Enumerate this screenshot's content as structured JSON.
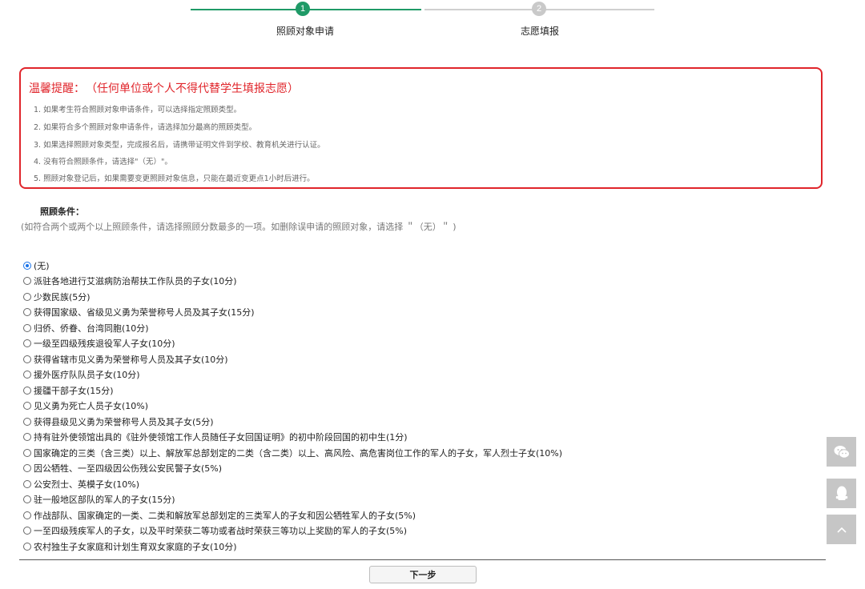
{
  "stepper": {
    "steps": [
      {
        "number": "1",
        "label": "照顾对象申请",
        "state": "active"
      },
      {
        "number": "2",
        "label": "志愿填报",
        "state": "inactive"
      }
    ],
    "colors": {
      "active": "#1f9a67",
      "inactive": "#c9c9c9"
    }
  },
  "notice": {
    "title": "温馨提醒：",
    "title_paren": "（任何单位或个人不得代替学生填报志愿）",
    "items": [
      "1. 如果考生符合照顾对象申请条件，可以选择指定照顾类型。",
      "2. 如果符合多个照顾对象申请条件，请选择加分最高的照顾类型。",
      "3. 如果选择照顾对象类型，完成报名后，请携带证明文件到学校、教育机关进行认证。",
      "4. 没有符合照顾条件，请选择\"（无）\"。",
      "5. 照顾对象登记后，如果需要变更照顾对象信息，只能在最近变更点1小时后进行。"
    ],
    "color": "#e0252b"
  },
  "conditions": {
    "title": "照顾条件：",
    "hint": "(如符合两个或两个以上照顾条件，请选择照顾分数最多的一项。如删除误申请的照顾对象，请选择 ＂（无）＂ )",
    "selected_index": 0,
    "options": [
      "(无)",
      "派驻各地进行艾滋病防治帮扶工作队员的子女(10分)",
      "少数民族(5分)",
      "获得国家级、省级见义勇为荣誉称号人员及其子女(15分)",
      "归侨、侨眷、台湾同胞(10分)",
      "一级至四级残疾退役军人子女(10分)",
      "获得省辖市见义勇为荣誉称号人员及其子女(10分)",
      "援外医疗队队员子女(10分)",
      "援疆干部子女(15分)",
      "见义勇为死亡人员子女(10%)",
      "获得县级见义勇为荣誉称号人员及其子女(5分)",
      "持有驻外使领馆出具的《驻外使领馆工作人员随任子女回国证明》的初中阶段回国的初中生(1分)",
      "国家确定的三类（含三类）以上、解放军总部划定的二类（含二类）以上、高风险、高危害岗位工作的军人的子女，军人烈士子女(10%)",
      "因公牺牲、一至四级因公伤残公安民警子女(5%)",
      "公安烈士、英模子女(10%)",
      "驻一般地区部队的军人的子女(15分)",
      "作战部队、国家确定的一类、二类和解放军总部划定的三类军人的子女和因公牺牲军人的子女(5%)",
      "一至四级残疾军人的子女，以及平时荣获二等功或者战时荣获三等功以上奖励的军人的子女(5%)",
      "农村独生子女家庭和计划生育双女家庭的子女(10分)"
    ]
  },
  "actions": {
    "next_label": "下一步"
  },
  "float_tools": [
    {
      "icon": "wechat-icon"
    },
    {
      "icon": "qq-icon"
    },
    {
      "icon": "back-to-top-icon"
    }
  ]
}
